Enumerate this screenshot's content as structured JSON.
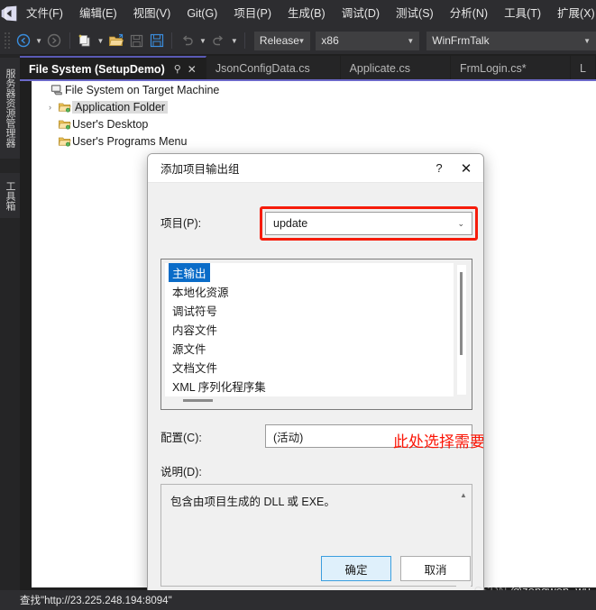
{
  "menubar": {
    "logo_icon": "visual-studio-logo",
    "items": [
      {
        "label": "文件(F)"
      },
      {
        "label": "编辑(E)"
      },
      {
        "label": "视图(V)"
      },
      {
        "label": "Git(G)"
      },
      {
        "label": "项目(P)"
      },
      {
        "label": "生成(B)"
      },
      {
        "label": "调试(D)"
      },
      {
        "label": "测试(S)"
      },
      {
        "label": "分析(N)"
      },
      {
        "label": "工具(T)"
      },
      {
        "label": "扩展(X)"
      }
    ]
  },
  "toolbar": {
    "icons": [
      "navigate-back-icon",
      "navigate-forward-icon",
      "new-project-icon",
      "open-file-icon",
      "save-icon",
      "save-all-icon",
      "undo-icon",
      "redo-icon"
    ],
    "configuration": "Release",
    "platform": "x86",
    "startup_project": "WinFrmTalk"
  },
  "left_dock": {
    "server_explorer": "服务器资源管理器",
    "toolbox": "工具箱"
  },
  "tabs": [
    {
      "label": "File System (SetupDemo)",
      "active": true,
      "pin_icon": "pin-icon",
      "close_icon": "close-icon"
    },
    {
      "label": "JsonConfigData.cs",
      "active": false
    },
    {
      "label": "Applicate.cs",
      "active": false
    },
    {
      "label": "FrmLogin.cs*",
      "active": false
    },
    {
      "label": "L",
      "active": false
    }
  ],
  "designer": {
    "tree": [
      {
        "label": "File System on Target Machine",
        "icon": "computer-icon",
        "indent": 0,
        "expander": "",
        "selected": false
      },
      {
        "label": "Application Folder",
        "icon": "folder-icon",
        "indent": 1,
        "expander": "›",
        "selected": true
      },
      {
        "label": "User's Desktop",
        "icon": "folder-icon",
        "indent": 1,
        "expander": "",
        "selected": false
      },
      {
        "label": "User's Programs Menu",
        "icon": "folder-icon",
        "indent": 1,
        "expander": "",
        "selected": false
      }
    ]
  },
  "dialog": {
    "title": "添加项目输出组",
    "help_icon": "?",
    "close_icon": "✕",
    "project_label": "项目(P):",
    "project_value": "update",
    "output_groups": [
      {
        "label": "主输出",
        "selected": true
      },
      {
        "label": "本地化资源",
        "selected": false
      },
      {
        "label": "调试符号",
        "selected": false
      },
      {
        "label": "内容文件",
        "selected": false
      },
      {
        "label": "源文件",
        "selected": false
      },
      {
        "label": "文档文件",
        "selected": false
      },
      {
        "label": "XML 序列化程序集",
        "selected": false
      }
    ],
    "config_label": "配置(C):",
    "config_value": "(活动)",
    "description_label": "说明(D):",
    "description_text": "包含由项目生成的 DLL 或 EXE。",
    "ok_label": "确定",
    "cancel_label": "取消",
    "scroll_up_icon": "▲",
    "scroll_down_icon": "▼",
    "chevron_icon": "⌄"
  },
  "annotation": {
    "text": "此处选择需要打包的主项目",
    "arrow_icon": "up-arrow-icon",
    "color": "#fb1405",
    "highlight_color": "#f61c0b"
  },
  "statusbar": {
    "text": "查找\"http://23.225.248.194:8094\""
  },
  "watermark": {
    "brand": "CSDN",
    "author": "@zongwen_wu"
  }
}
